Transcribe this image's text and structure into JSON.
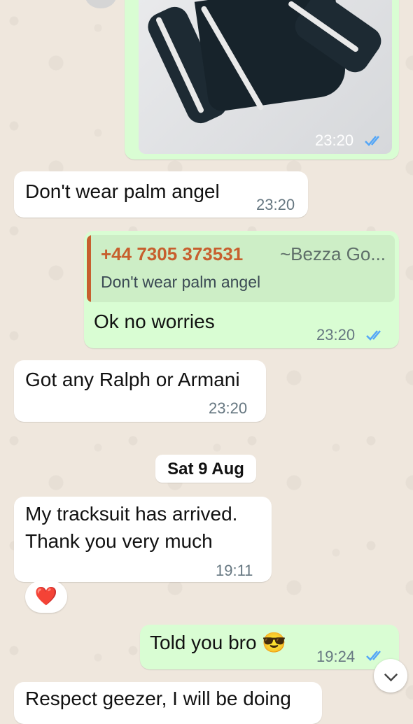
{
  "messages": {
    "image_msg": {
      "time": "23:20"
    },
    "m1": {
      "text": "Don't wear palm angel",
      "time": "23:20"
    },
    "m2": {
      "quote_name": "+44 7305 373531",
      "quote_alias": "~Bezza Go...",
      "quote_text": "Don't wear palm angel",
      "text": "Ok no worries",
      "time": "23:20"
    },
    "m3": {
      "text": "Got any Ralph or Armani",
      "time": "23:20"
    },
    "date_separator": "Sat 9 Aug",
    "m4": {
      "line1": "My tracksuit has arrived.",
      "line2": "Thank you very much",
      "time": "19:11",
      "reaction": "❤️"
    },
    "m5": {
      "text": "Told you bro 😎",
      "time": "19:24"
    },
    "m6": {
      "text": "Respect geezer, I will be doing"
    }
  },
  "icons": {
    "read_receipt": "double-check-icon",
    "scroll_down": "chevron-down-icon"
  },
  "colors": {
    "incoming": "#ffffff",
    "outgoing": "#d9fdd3",
    "read_tick": "#53a6f7",
    "quote_accent": "#c75f2e"
  }
}
